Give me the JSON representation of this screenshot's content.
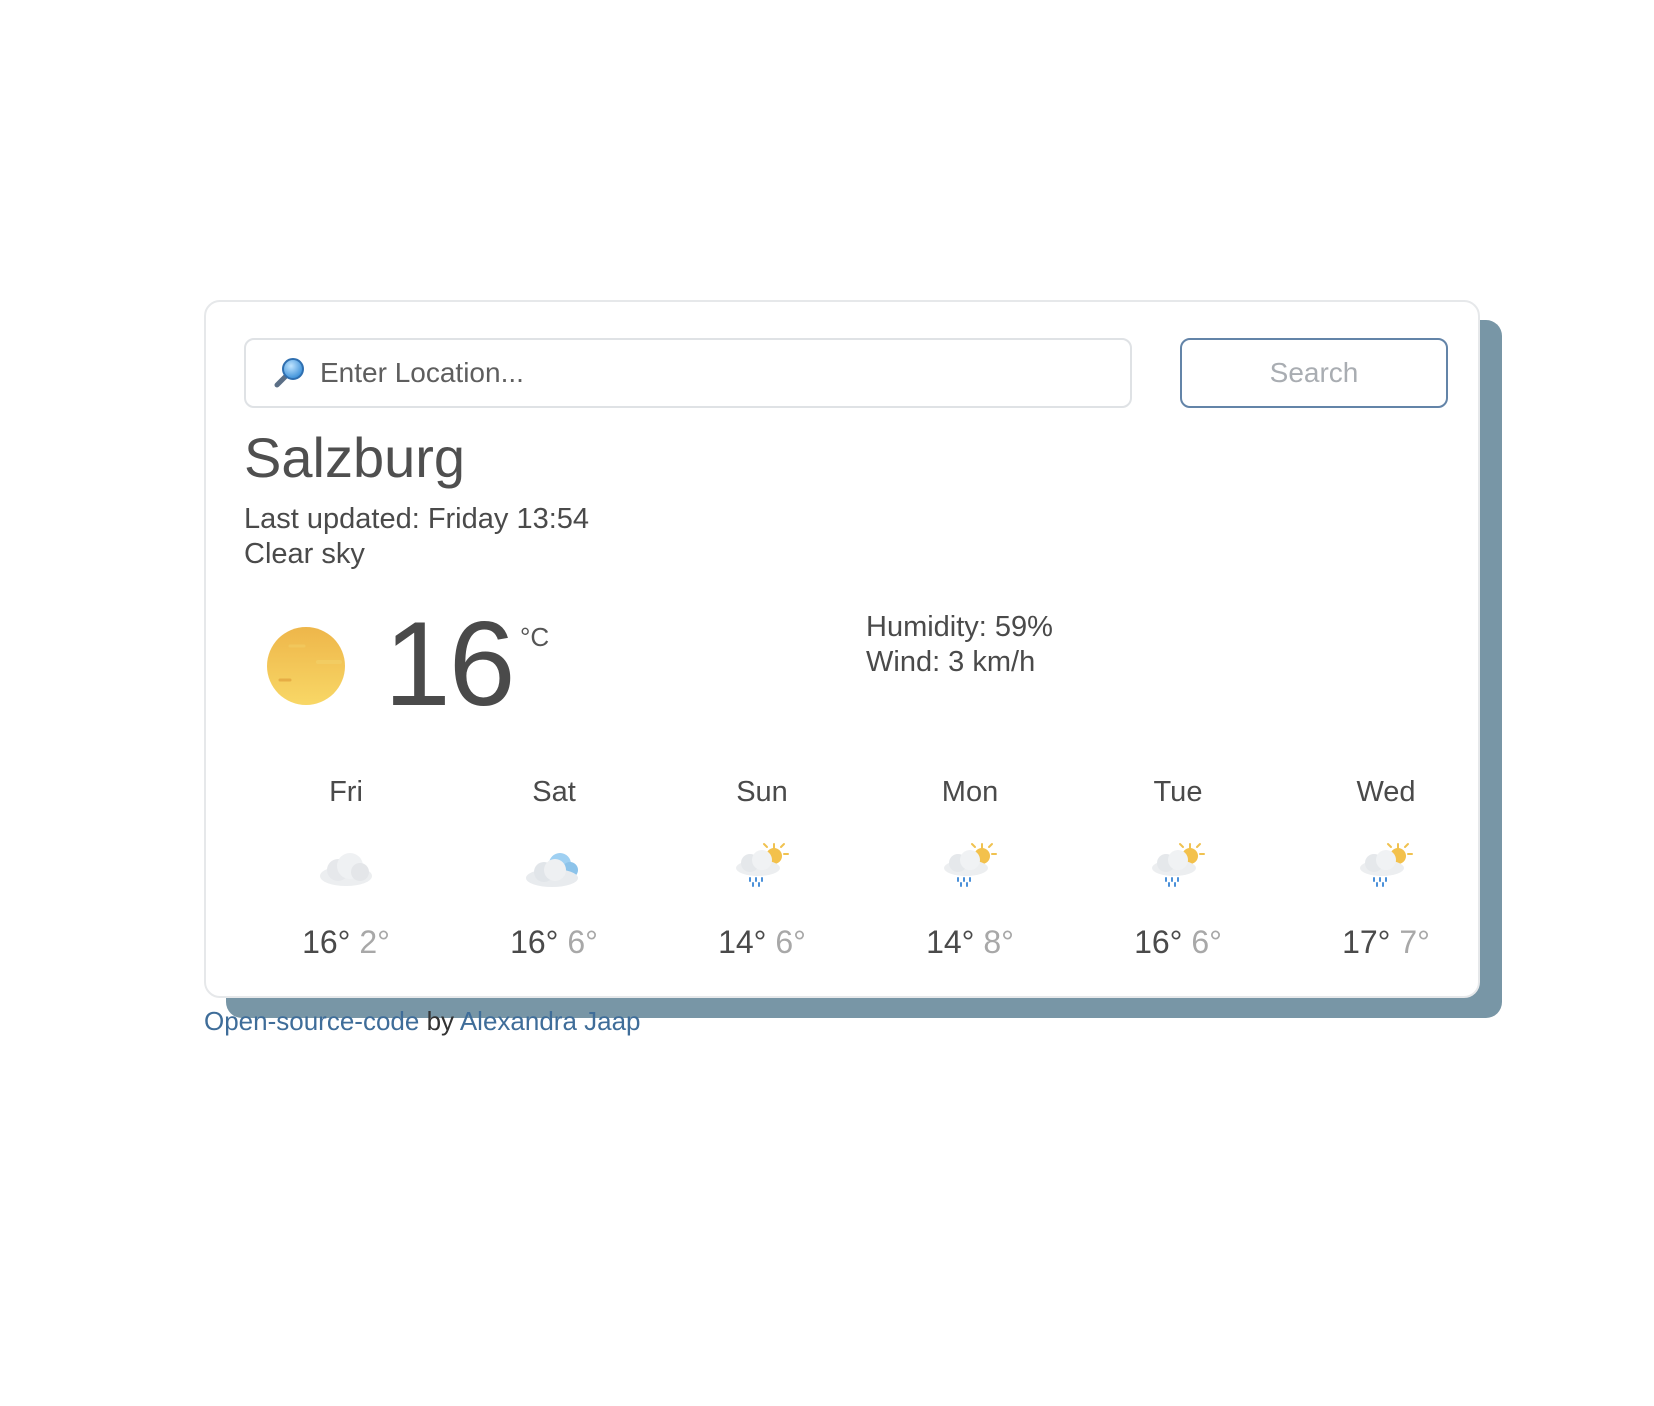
{
  "search": {
    "placeholder": "Enter Location...",
    "button_label": "Search"
  },
  "current": {
    "city": "Salzburg",
    "last_updated": "Last updated: Friday 13:54",
    "description": "Clear sky",
    "temperature": "16",
    "unit": "°C",
    "icon": "sun-icon",
    "humidity": "Humidity: 59%",
    "wind": "Wind: 3 km/h"
  },
  "forecast": [
    {
      "day": "Fri",
      "max": "16°",
      "min": "2°",
      "icon": "cloud-icon"
    },
    {
      "day": "Sat",
      "max": "16°",
      "min": "6°",
      "icon": "cloudy-icon"
    },
    {
      "day": "Sun",
      "max": "14°",
      "min": "6°",
      "icon": "sun-rain-icon"
    },
    {
      "day": "Mon",
      "max": "14°",
      "min": "8°",
      "icon": "sun-rain-icon"
    },
    {
      "day": "Tue",
      "max": "16°",
      "min": "6°",
      "icon": "sun-rain-icon"
    },
    {
      "day": "Wed",
      "max": "17°",
      "min": "7°",
      "icon": "sun-rain-icon"
    }
  ],
  "footer": {
    "code_link": "Open-source-code",
    "by": " by ",
    "author_link": "Alexandra Jaap"
  },
  "colors": {
    "shadow": "#7896a6",
    "button_border": "#6384a8",
    "link": "#3f6d99",
    "sun": "#f4c24d"
  }
}
